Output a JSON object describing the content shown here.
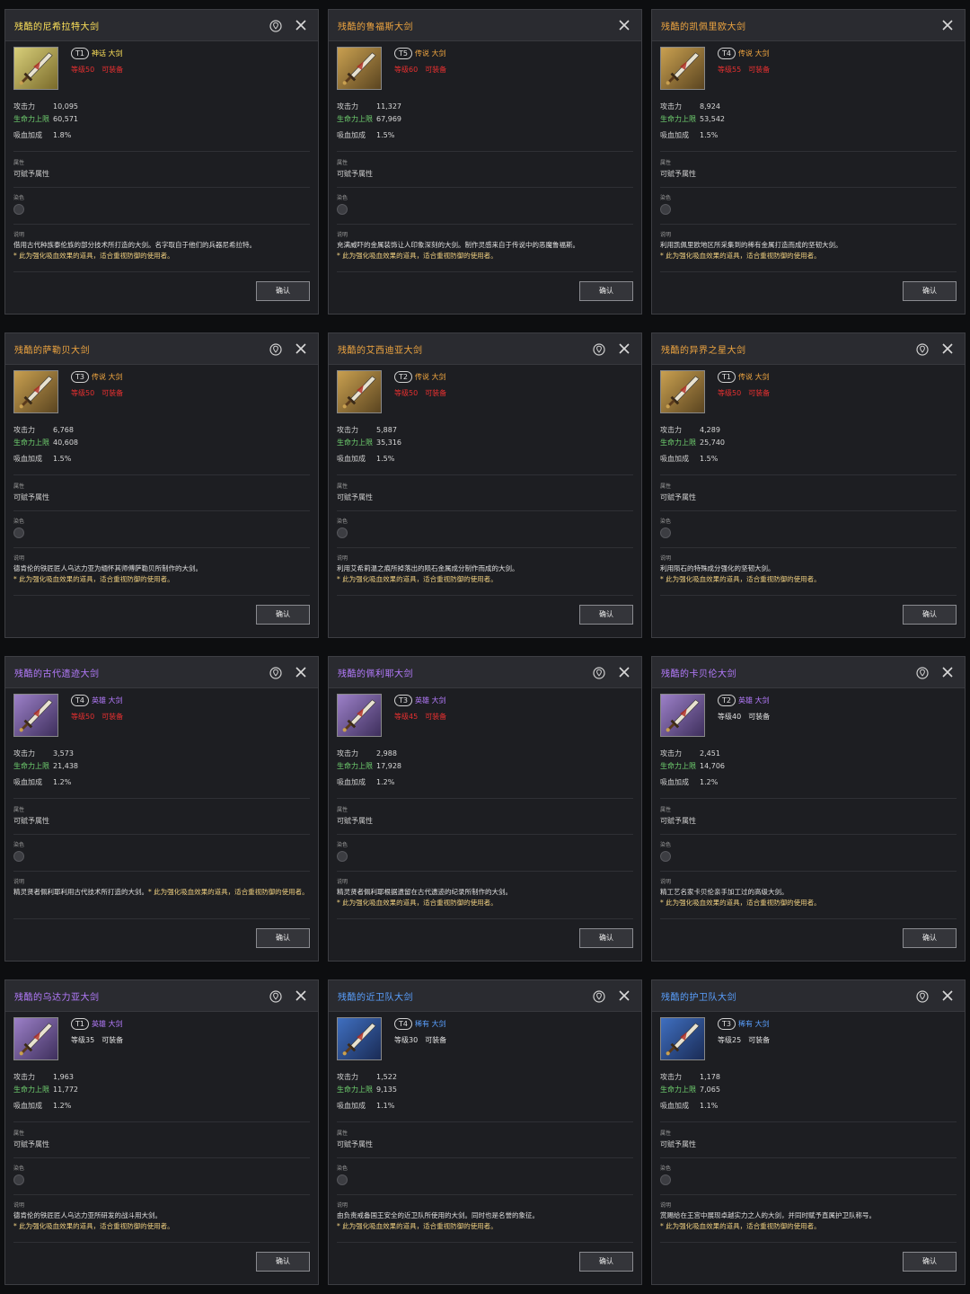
{
  "labels": {
    "attack": "攻击力",
    "hp": "生命力上限",
    "lifesteal": "吸血加成",
    "attribute_head": "属性",
    "attribute_text": "可赋予属性",
    "dye_head": "染色",
    "desc_head": "说明",
    "confirm": "确认"
  },
  "colors": {
    "legendary": "#f0a640",
    "mythic": "#ffe35a",
    "heroic": "#b67cff",
    "rare": "#5aa0ff",
    "req_red": "#e83030",
    "green": "#6fd06f"
  },
  "cards": [
    {
      "title": "残酷的尼希拉特大剑",
      "rarity": "mythic",
      "tier": "T1",
      "type": "神话 大剑",
      "level": "等级50",
      "equip": "可装备",
      "req_red": true,
      "attack": "10,095",
      "hp": "60,571",
      "lifesteal": "1.8%",
      "desc": "借用古代种族泰伦族的部分技术所打造的大剑。名字取自于他们的兵器尼希拉特。",
      "note": "* 此为强化吸血效果的道具，适合重视防御的使用者。",
      "pin": true
    },
    {
      "title": "残酷的鲁福斯大剑",
      "rarity": "legendary",
      "tier": "T5",
      "type": "传说 大剑",
      "level": "等级60",
      "equip": "可装备",
      "req_red": true,
      "attack": "11,327",
      "hp": "67,969",
      "lifesteal": "1.5%",
      "desc": "充满威吓的金属装饰让人印象深刻的大剑。制作灵感来自于传说中的恶魔鲁福斯。",
      "note": "* 此为强化吸血效果的道具，适合重视防御的使用者。",
      "pin": false
    },
    {
      "title": "残酷的凯佩里欧大剑",
      "rarity": "legendary",
      "tier": "T4",
      "type": "传说 大剑",
      "level": "等级55",
      "equip": "可装备",
      "req_red": true,
      "attack": "8,924",
      "hp": "53,542",
      "lifesteal": "1.5%",
      "desc": "利用凯佩里欧地区所采集到的稀有金属打造而成的坚韧大剑。",
      "note": "* 此为强化吸血效果的道具，适合重视防御的使用者。",
      "pin": false
    },
    {
      "title": "残酷的萨勒贝大剑",
      "rarity": "legendary",
      "tier": "T3",
      "type": "传说 大剑",
      "level": "等级50",
      "equip": "可装备",
      "req_red": true,
      "attack": "6,768",
      "hp": "40,608",
      "lifesteal": "1.5%",
      "desc": "德肯伦的铁匠匠人乌达力亚为缅怀其师傅萨勒贝所制作的大剑。",
      "note": "* 此为强化吸血效果的道具，适合重视防御的使用者。",
      "pin": true
    },
    {
      "title": "残酷的艾西迪亚大剑",
      "rarity": "legendary",
      "tier": "T2",
      "type": "传说 大剑",
      "level": "等级50",
      "equip": "可装备",
      "req_red": true,
      "attack": "5,887",
      "hp": "35,316",
      "lifesteal": "1.5%",
      "desc": "利用艾希莉温之痕所掉落出的陨石金属成分制作而成的大剑。",
      "note": "* 此为强化吸血效果的道具，适合重视防御的使用者。",
      "pin": true
    },
    {
      "title": "残酷的异界之星大剑",
      "rarity": "legendary",
      "tier": "T1",
      "type": "传说 大剑",
      "level": "等级50",
      "equip": "可装备",
      "req_red": true,
      "attack": "4,289",
      "hp": "25,740",
      "lifesteal": "1.5%",
      "desc": "利用陨石的特殊成分强化的坚韧大剑。",
      "note": "* 此为强化吸血效果的道具，适合重视防御的使用者。",
      "pin": true
    },
    {
      "title": "残酷的古代遗迹大剑",
      "rarity": "heroic",
      "tier": "T4",
      "type": "英雄 大剑",
      "level": "等级50",
      "equip": "可装备",
      "req_red": true,
      "attack": "3,573",
      "hp": "21,438",
      "lifesteal": "1.2%",
      "desc": "精灵贤者佩利耶利用古代技术所打造的大剑。",
      "note": "* 此为强化吸血效果的道具，适合重视防御的使用者。",
      "inline": true,
      "pin": true
    },
    {
      "title": "残酷的佩利耶大剑",
      "rarity": "heroic",
      "tier": "T3",
      "type": "英雄 大剑",
      "level": "等级45",
      "equip": "可装备",
      "req_red": true,
      "attack": "2,988",
      "hp": "17,928",
      "lifesteal": "1.2%",
      "desc": "精灵贤者佩利耶根据遗留在古代遗迹的纪录所制作的大剑。",
      "note": "* 此为强化吸血效果的道具，适合重视防御的使用者。",
      "pin": true
    },
    {
      "title": "残酷的卡贝伦大剑",
      "rarity": "heroic",
      "tier": "T2",
      "type": "英雄 大剑",
      "level": "等级40",
      "equip": "可装备",
      "req_red": false,
      "attack": "2,451",
      "hp": "14,706",
      "lifesteal": "1.2%",
      "desc": "精工艺名家卡贝伦亲手加工过的高级大剑。",
      "note": "* 此为强化吸血效果的道具，适合重视防御的使用者。",
      "pin": true
    },
    {
      "title": "残酷的乌达力亚大剑",
      "rarity": "heroic",
      "tier": "T1",
      "type": "英雄 大剑",
      "level": "等级35",
      "equip": "可装备",
      "req_red": false,
      "attack": "1,963",
      "hp": "11,772",
      "lifesteal": "1.2%",
      "desc": "德肯伦的铁匠匠人乌达力亚所研发的战斗用大剑。",
      "note": "* 此为强化吸血效果的道具，适合重视防御的使用者。",
      "pin": true
    },
    {
      "title": "残酷的近卫队大剑",
      "rarity": "rare",
      "tier": "T4",
      "type": "稀有 大剑",
      "level": "等级30",
      "equip": "可装备",
      "req_red": false,
      "attack": "1,522",
      "hp": "9,135",
      "lifesteal": "1.1%",
      "desc": "由负责戒备国王安全的近卫队所使用的大剑。同时也是名誉的象征。",
      "note": "* 此为强化吸血效果的道具，适合重视防御的使用者。",
      "pin": true
    },
    {
      "title": "残酷的护卫队大剑",
      "rarity": "rare",
      "tier": "T3",
      "type": "稀有 大剑",
      "level": "等级25",
      "equip": "可装备",
      "req_red": false,
      "attack": "1,178",
      "hp": "7,065",
      "lifesteal": "1.1%",
      "desc": "赏赐给在王宫中展现卓越实力之人的大剑，并同时赋予直属护卫队称号。",
      "note": "* 此为强化吸血效果的道具，适合重视防御的使用者。",
      "pin": true
    }
  ]
}
